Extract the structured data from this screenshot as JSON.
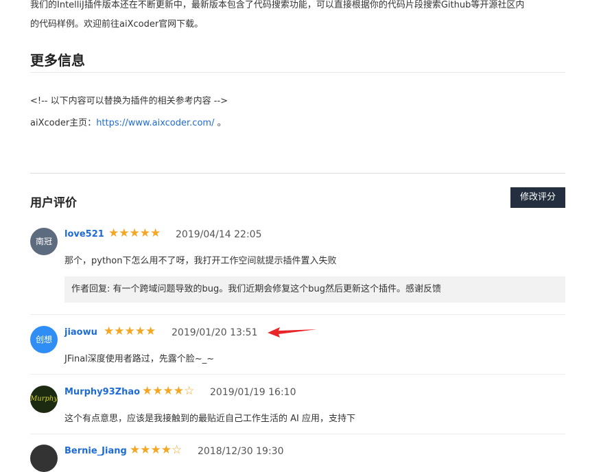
{
  "intro": {
    "line1": "我们的IntelliJ插件版本还在不断更新中，最新版本包含了代码搜索功能，可以直接根据你的代码片段搜索Github等开源社区内",
    "line2": "的代码样例。欢迎前往aiXcoder官网下载。"
  },
  "more_info": {
    "title": "更多信息",
    "comment": "<!-- 以下内容可以替换为插件的相关参考内容 -->",
    "homepage_label": "aiXcoder主页：",
    "homepage_link": "https://www.aixcoder.com/",
    "homepage_suffix": " 。"
  },
  "reviews_section": {
    "title": "用户评价",
    "edit_button": "修改评分"
  },
  "reviews": [
    {
      "avatar_text": "南冠",
      "avatar_color": "#5d6b7e",
      "username": "love521",
      "stars": 5,
      "date": "2019/04/14 22:05",
      "text": "那个，python下怎么用不了呀，我打开工作空间就提示插件置入失败",
      "reply": "作者回复: 有一个跨域问题导致的bug。我们近期会修复这个bug然后更新这个插件。感谢反馈"
    },
    {
      "avatar_text": "创想",
      "avatar_color": "#2f8ef5",
      "username": "jiaowu",
      "stars": 5,
      "date": "2019/01/20 13:51",
      "text": "JFinal深度使用者路过，先露个脸~_~"
    },
    {
      "avatar_text": "Murphy",
      "avatar_color": "#1d2a12",
      "username": "Murphy93Zhao",
      "stars": 4,
      "date": "2019/01/19 16:10",
      "text": "这个有点意思，应该是我接触到的最贴近自己工作生活的 AI 应用，支持下"
    },
    {
      "avatar_text": "",
      "avatar_color": "#333333",
      "username": "Bernie_Jiang",
      "stars": 4,
      "date": "2018/12/30 19:30"
    }
  ],
  "star_on": "★",
  "star_off": "☆",
  "colors": {
    "accent_link": "#1e6bd6",
    "star": "#f5a623",
    "annotation_arrow": "#e8262a",
    "button_bg": "#232f3e"
  }
}
